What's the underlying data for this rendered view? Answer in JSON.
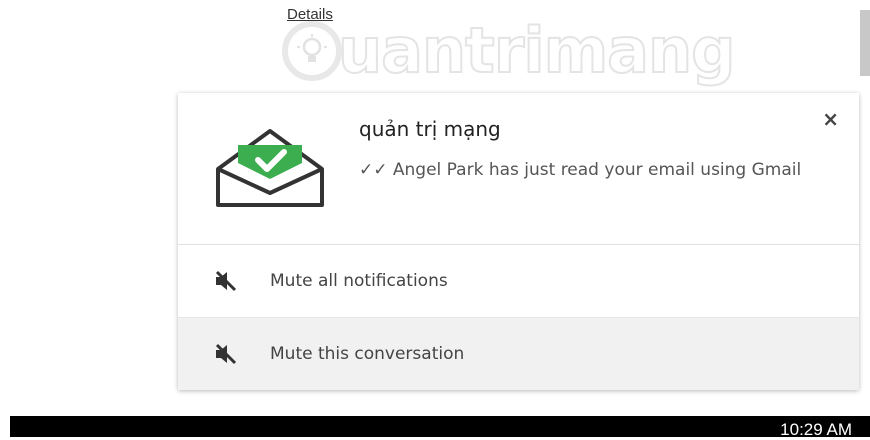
{
  "link": {
    "details": "Details"
  },
  "watermark": {
    "text": "uantrimang"
  },
  "notification": {
    "title": "quản trị mạng",
    "message": "✓✓ Angel Park has just read your email using Gmail",
    "close_label": "×",
    "actions": [
      {
        "label": "Mute all notifications",
        "icon": "mute-icon"
      },
      {
        "label": "Mute this conversation",
        "icon": "mute-icon"
      }
    ],
    "icon": "open-envelope-check-icon",
    "accent_color": "#3cae4f"
  },
  "taskbar": {
    "clock": "10:29 AM"
  }
}
